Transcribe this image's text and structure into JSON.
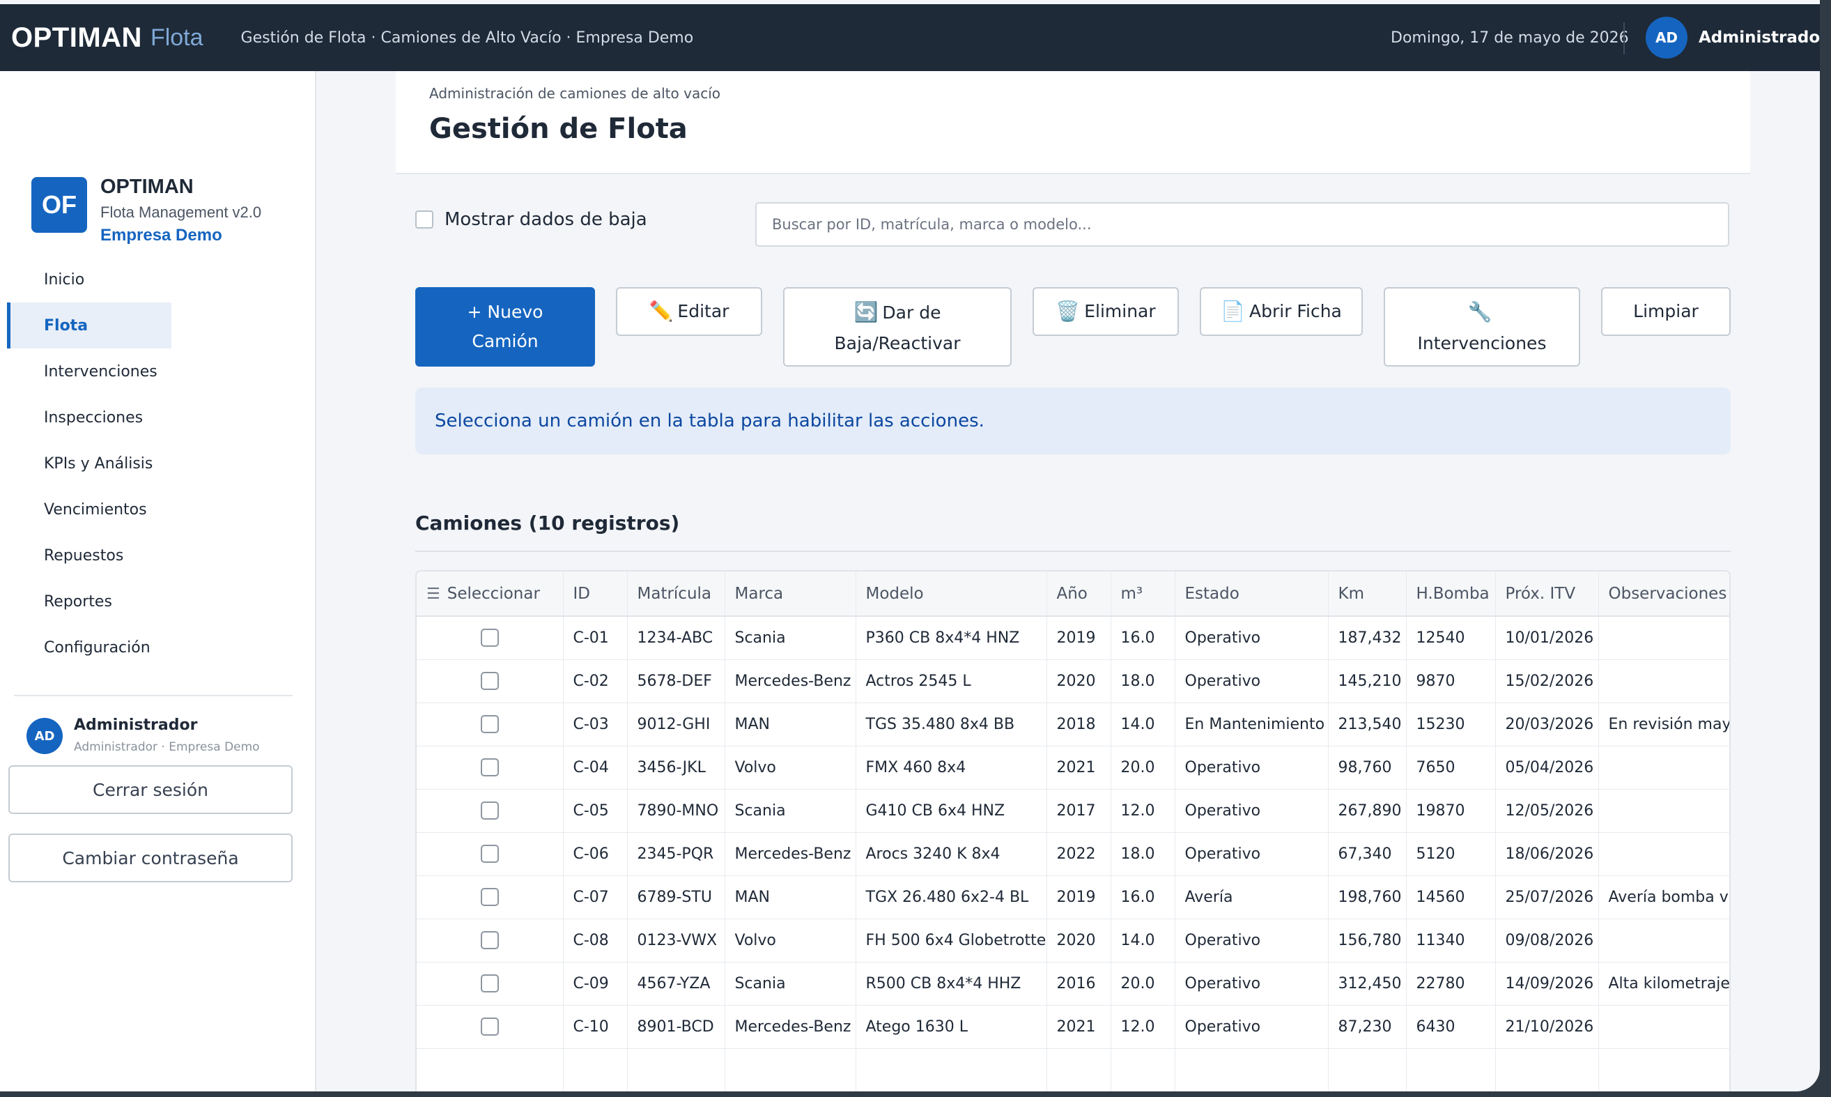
{
  "topbar": {
    "logo": "OPTIMAN",
    "logo_sub": "Flota",
    "breadcrumb": "Gestión de Flota · Camiones de Alto Vacío · Empresa Demo",
    "date": "Domingo, 17 de mayo de 2026",
    "avatar": "AD",
    "user": "Administrador"
  },
  "sidebar": {
    "brand_initials": "OF",
    "brand_name": "OPTIMAN",
    "brand_version": "Flota Management v2.0",
    "brand_company": "Empresa Demo",
    "items": [
      {
        "label": "Inicio"
      },
      {
        "label": "Flota"
      },
      {
        "label": "Intervenciones"
      },
      {
        "label": "Inspecciones"
      },
      {
        "label": "KPIs y Análisis"
      },
      {
        "label": "Vencimientos"
      },
      {
        "label": "Repuestos"
      },
      {
        "label": "Reportes"
      },
      {
        "label": "Configuración"
      }
    ],
    "active_item": "Flota",
    "user_avatar": "AD",
    "user_name": "Administrador",
    "user_role": "Administrador · Empresa Demo",
    "logout": "Cerrar sesión",
    "change_password": "Cambiar contraseña"
  },
  "header": {
    "breadcrumb": "Administración de camiones de alto vacío",
    "title": "Gestión de Flota"
  },
  "filters": {
    "show_retired_label": "Mostrar dados de baja",
    "show_retired_checked": false,
    "search_placeholder": "Buscar por ID, matrícula, marca o modelo...",
    "search_value": ""
  },
  "toolbar": {
    "new_line1": "+ Nuevo",
    "new_line2": "Camión",
    "edit": "Editar",
    "edit_icon": "pencil-icon",
    "retire_line1": "Dar de",
    "retire_line2": "Baja/Reactivar",
    "retire_icon": "refresh-icon",
    "delete": "Eliminar",
    "delete_icon": "trash-icon",
    "open": "Abrir Ficha",
    "open_icon": "document-icon",
    "interventions": "Intervenciones",
    "interventions_icon": "wrench-icon",
    "clear": "Limpiar"
  },
  "info_message": "Selecciona un camión en la tabla para habilitar las acciones.",
  "table": {
    "title": "Camiones (10 registros)",
    "columns": {
      "select": "Seleccionar",
      "id": "ID",
      "plate": "Matrícula",
      "brand": "Marca",
      "model": "Modelo",
      "year": "Año",
      "m3": "m³",
      "status": "Estado",
      "km": "Km",
      "pump": "H.Bomba",
      "itv": "Próx. ITV",
      "notes": "Observaciones"
    },
    "rows": [
      {
        "id": "C-01",
        "plate": "1234-ABC",
        "brand": "Scania",
        "model": "P360 CB 8x4*4 HNZ",
        "year": "2019",
        "m3": "16.0",
        "status": "Operativo",
        "km": "187,432",
        "pump": "12540",
        "itv": "10/01/2026",
        "notes": ""
      },
      {
        "id": "C-02",
        "plate": "5678-DEF",
        "brand": "Mercedes-Benz",
        "model": "Actros 2545 L",
        "year": "2020",
        "m3": "18.0",
        "status": "Operativo",
        "km": "145,210",
        "pump": "9870",
        "itv": "15/02/2026",
        "notes": ""
      },
      {
        "id": "C-03",
        "plate": "9012-GHI",
        "brand": "MAN",
        "model": "TGS 35.480 8x4 BB",
        "year": "2018",
        "m3": "14.0",
        "status": "En Mantenimiento",
        "km": "213,540",
        "pump": "15230",
        "itv": "20/03/2026",
        "notes": "En revisión mayo"
      },
      {
        "id": "C-04",
        "plate": "3456-JKL",
        "brand": "Volvo",
        "model": "FMX 460 8x4",
        "year": "2021",
        "m3": "20.0",
        "status": "Operativo",
        "km": "98,760",
        "pump": "7650",
        "itv": "05/04/2026",
        "notes": ""
      },
      {
        "id": "C-05",
        "plate": "7890-MNO",
        "brand": "Scania",
        "model": "G410 CB 6x4 HNZ",
        "year": "2017",
        "m3": "12.0",
        "status": "Operativo",
        "km": "267,890",
        "pump": "19870",
        "itv": "12/05/2026",
        "notes": ""
      },
      {
        "id": "C-06",
        "plate": "2345-PQR",
        "brand": "Mercedes-Benz",
        "model": "Arocs 3240 K 8x4",
        "year": "2022",
        "m3": "18.0",
        "status": "Operativo",
        "km": "67,340",
        "pump": "5120",
        "itv": "18/06/2026",
        "notes": ""
      },
      {
        "id": "C-07",
        "plate": "6789-STU",
        "brand": "MAN",
        "model": "TGX 26.480 6x2-4 BL",
        "year": "2019",
        "m3": "16.0",
        "status": "Avería",
        "km": "198,760",
        "pump": "14560",
        "itv": "25/07/2026",
        "notes": "Avería bomba vac"
      },
      {
        "id": "C-08",
        "plate": "0123-VWX",
        "brand": "Volvo",
        "model": "FH 500 6x4 Globetrotter",
        "year": "2020",
        "m3": "14.0",
        "status": "Operativo",
        "km": "156,780",
        "pump": "11340",
        "itv": "09/08/2026",
        "notes": ""
      },
      {
        "id": "C-09",
        "plate": "4567-YZA",
        "brand": "Scania",
        "model": "R500 CB 8x4*4 HHZ",
        "year": "2016",
        "m3": "20.0",
        "status": "Operativo",
        "km": "312,450",
        "pump": "22780",
        "itv": "14/09/2026",
        "notes": "Alta kilometraje, ("
      },
      {
        "id": "C-10",
        "plate": "8901-BCD",
        "brand": "Mercedes-Benz",
        "model": "Atego 1630 L",
        "year": "2021",
        "m3": "12.0",
        "status": "Operativo",
        "km": "87,230",
        "pump": "6430",
        "itv": "21/10/2026",
        "notes": ""
      }
    ]
  },
  "colors": {
    "topbar": "#1e2a38",
    "accent": "#1565c0",
    "info_bg": "#e3ecf8",
    "info_text": "#0d47a1"
  }
}
